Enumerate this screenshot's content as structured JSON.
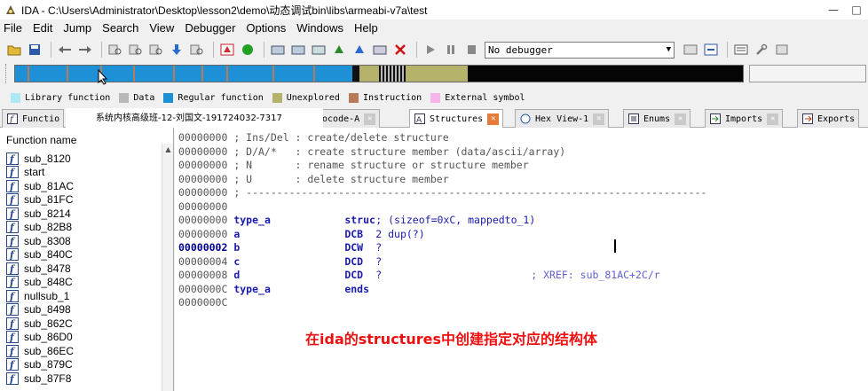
{
  "window": {
    "title": "IDA - C:\\Users\\Administrator\\Desktop\\lesson2\\demo\\动态调试bin\\libs\\armeabi-v7a\\test",
    "controls": [
      "minimize-icon",
      "maximize-icon"
    ]
  },
  "menu": [
    "File",
    "Edit",
    "Jump",
    "Search",
    "View",
    "Debugger",
    "Options",
    "Windows",
    "Help"
  ],
  "toolbar": {
    "debugger_select": "No debugger"
  },
  "legend": [
    {
      "label": "Library function",
      "color": "#aee8f4"
    },
    {
      "label": "Data",
      "color": "#b8b8b8"
    },
    {
      "label": "Regular function",
      "color": "#1e90d6"
    },
    {
      "label": "Unexplored",
      "color": "#b5b36b"
    },
    {
      "label": "Instruction",
      "color": "#b97a57"
    },
    {
      "label": "External symbol",
      "color": "#f4b6e8"
    }
  ],
  "tabs": [
    {
      "label": "Functio",
      "icon": "function-icon"
    },
    {
      "label": "docode-A",
      "icon": "pseudocode-icon"
    },
    {
      "label": "Structures",
      "icon": "structures-icon",
      "active": true
    },
    {
      "label": "Hex View-1",
      "icon": "hex-icon"
    },
    {
      "label": "Enums",
      "icon": "enums-icon"
    },
    {
      "label": "Imports",
      "icon": "imports-icon"
    },
    {
      "label": "Exports",
      "icon": "exports-icon"
    }
  ],
  "watermark": "系统内核高级班-12-刘国文-191724032-7317",
  "functions": {
    "header": "Function name",
    "items": [
      "sub_8120",
      "start",
      "sub_81AC",
      "sub_81FC",
      "sub_8214",
      "sub_82B8",
      "sub_8308",
      "sub_840C",
      "sub_8478",
      "sub_848C",
      "nullsub_1",
      "sub_8498",
      "sub_862C",
      "sub_86D0",
      "sub_86EC",
      "sub_879C",
      "sub_87F8"
    ]
  },
  "structures": {
    "lines": [
      {
        "addr": "00000000",
        "text": " ; Ins/Del : create/delete structure"
      },
      {
        "addr": "00000000",
        "text": " ; D/A/*   : create structure member (data/ascii/array)"
      },
      {
        "addr": "00000000",
        "text": " ; N       : rename structure or structure member"
      },
      {
        "addr": "00000000",
        "text": " ; U       : delete structure member"
      },
      {
        "addr": "00000000",
        "text": " ; ---------------------------------------------------------------------------"
      },
      {
        "addr": "00000000",
        "text": ""
      },
      {
        "addr": "00000000",
        "name": "type_a",
        "op": "struc",
        "arg": "; (sizeof=0xC, mappedto_1)"
      },
      {
        "addr": "00000000",
        "name": "a",
        "op": "DCB",
        "arg": "2 dup(?)"
      },
      {
        "addr": "00000002",
        "name": "b",
        "op": "DCW",
        "arg": "?",
        "bold": true
      },
      {
        "addr": "00000004",
        "name": "c",
        "op": "DCD",
        "arg": "?"
      },
      {
        "addr": "00000008",
        "name": "d",
        "op": "DCD",
        "arg": "?",
        "comment": "; XREF: sub_81AC+2C/r"
      },
      {
        "addr": "0000000C",
        "name": "type_a",
        "op": "ends",
        "arg": ""
      },
      {
        "addr": "0000000C",
        "text": ""
      }
    ]
  },
  "caption": "在ida的structures中创建指定对应的结构体"
}
